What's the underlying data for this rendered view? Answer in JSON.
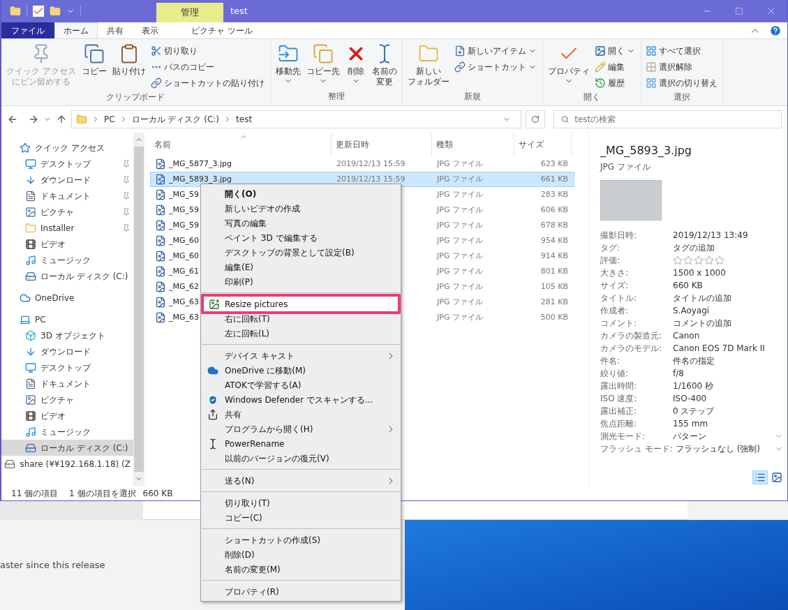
{
  "window": {
    "title": "test",
    "context_header": "管理"
  },
  "ribbon_tabs": [
    {
      "label": "ファイル",
      "kind": "file",
      "selected": false
    },
    {
      "label": "ホーム",
      "kind": "tab",
      "selected": true
    },
    {
      "label": "共有",
      "kind": "tab",
      "selected": false
    },
    {
      "label": "表示",
      "kind": "tab",
      "selected": false
    },
    {
      "label": "ピクチャ ツール",
      "kind": "context",
      "selected": false
    }
  ],
  "ribbon_groups": [
    {
      "label": "クリップボード",
      "large": [
        {
          "lines": [
            "クイック アクセス",
            "にピン留めする"
          ],
          "kind": "pin",
          "dropdown": false,
          "disabled": true
        },
        {
          "label": "コピー",
          "kind": "copy",
          "dropdown": false,
          "disabled": false
        },
        {
          "label": "貼り付け",
          "kind": "paste",
          "dropdown": false,
          "disabled": false
        }
      ],
      "small": [
        {
          "label": "切り取り",
          "kind": "cut",
          "dropdown": false
        },
        {
          "label": "パスのコピー",
          "kind": "path",
          "dropdown": false
        },
        {
          "label": "ショートカットの貼り付け",
          "kind": "shortcut",
          "dropdown": false
        }
      ]
    },
    {
      "label": "整理",
      "large": [
        {
          "label": "移動先",
          "kind": "move",
          "dropdown": true,
          "disabled": false
        },
        {
          "label": "コピー先",
          "kind": "copyto",
          "dropdown": true,
          "disabled": false
        },
        {
          "label": "削除",
          "kind": "delete",
          "dropdown": true,
          "disabled": false
        },
        {
          "lines": [
            "名前の",
            "変更"
          ],
          "kind": "rename",
          "dropdown": false,
          "disabled": false
        }
      ]
    },
    {
      "label": "新規",
      "large": [
        {
          "lines": [
            "新しい",
            "フォルダー"
          ],
          "kind": "folder",
          "dropdown": false,
          "disabled": false
        }
      ],
      "small": [
        {
          "label": "新しいアイテム",
          "kind": "newitem",
          "dropdown": true
        },
        {
          "label": "ショートカット",
          "kind": "shortcut",
          "dropdown": true
        }
      ]
    },
    {
      "label": "開く",
      "large": [
        {
          "label": "プロパティ",
          "kind": "properties",
          "dropdown": true,
          "disabled": false
        }
      ],
      "small": [
        {
          "label": "開く",
          "kind": "open",
          "dropdown": true
        },
        {
          "label": "編集",
          "kind": "edit",
          "dropdown": false
        },
        {
          "label": "履歴",
          "kind": "history",
          "dropdown": false
        }
      ]
    },
    {
      "label": "選択",
      "small": [
        {
          "label": "すべて選択",
          "kind": "selectall",
          "dropdown": false
        },
        {
          "label": "選択解除",
          "kind": "selectnone",
          "dropdown": false
        },
        {
          "label": "選択の切り替え",
          "kind": "invert",
          "dropdown": false
        }
      ]
    }
  ],
  "address": {
    "path": [
      "PC",
      "ローカル ディスク (C:)",
      "test"
    ]
  },
  "search": {
    "placeholder": "testの検索"
  },
  "nav": [
    {
      "label": "クイック アクセス",
      "kind": "star",
      "selected": false,
      "children": [
        {
          "label": "デスクトップ",
          "kind": "desktop",
          "pinned": true,
          "selected": false
        },
        {
          "label": "ダウンロード",
          "kind": "download",
          "pinned": true,
          "selected": false
        },
        {
          "label": "ドキュメント",
          "kind": "document",
          "pinned": true,
          "selected": false
        },
        {
          "label": "ピクチャ",
          "kind": "picture",
          "pinned": true,
          "selected": false
        },
        {
          "label": "Installer",
          "kind": "folder",
          "pinned": true,
          "selected": false
        },
        {
          "label": "ビデオ",
          "kind": "video",
          "pinned": false,
          "selected": false
        },
        {
          "label": "ミュージック",
          "kind": "music",
          "pinned": false,
          "selected": false
        },
        {
          "label": "ローカル ディスク (C:)",
          "kind": "drive",
          "pinned": false,
          "selected": false
        }
      ]
    },
    {
      "label": "OneDrive",
      "kind": "cloud",
      "selected": false
    },
    {
      "label": "PC",
      "kind": "pc",
      "selected": false,
      "children": [
        {
          "label": "3D オブジェクト",
          "kind": "cube",
          "pinned": false,
          "selected": false
        },
        {
          "label": "ダウンロード",
          "kind": "download",
          "pinned": false,
          "selected": false
        },
        {
          "label": "デスクトップ",
          "kind": "desktop",
          "pinned": false,
          "selected": false
        },
        {
          "label": "ドキュメント",
          "kind": "document",
          "pinned": false,
          "selected": false
        },
        {
          "label": "ピクチャ",
          "kind": "picture",
          "pinned": false,
          "selected": false
        },
        {
          "label": "ビデオ",
          "kind": "video",
          "pinned": false,
          "selected": false
        },
        {
          "label": "ミュージック",
          "kind": "music",
          "pinned": false,
          "selected": false
        },
        {
          "label": "ローカル ディスク (C:)",
          "kind": "drive",
          "pinned": false,
          "selected": true
        },
        {
          "label": "share (¥¥192.168.1.18) (Z",
          "kind": "network",
          "pinned": false,
          "selected": false
        }
      ]
    }
  ],
  "file_list": {
    "columns": [
      "名前",
      "更新日時",
      "種類",
      "サイズ"
    ],
    "rows": [
      {
        "name": "_MG_5877_3.jpg",
        "modified": "2019/12/13 15:59",
        "type": "JPG ファイル",
        "size": "623 KB",
        "selected": false
      },
      {
        "name": "_MG_5893_3.jpg",
        "modified": "2019/12/13 15:59",
        "type": "JPG ファイル",
        "size": "661 KB",
        "selected": true
      },
      {
        "name": "_MG_59",
        "type": "JPG ファイル",
        "size": "283 KB",
        "selected": false
      },
      {
        "name": "_MG_59",
        "type": "JPG ファイル",
        "size": "606 KB",
        "selected": false
      },
      {
        "name": "_MG_59",
        "type": "JPG ファイル",
        "size": "678 KB",
        "selected": false
      },
      {
        "name": "_MG_60",
        "type": "JPG ファイル",
        "size": "954 KB",
        "selected": false
      },
      {
        "name": "_MG_60",
        "type": "JPG ファイル",
        "size": "914 KB",
        "selected": false
      },
      {
        "name": "_MG_61",
        "type": "JPG ファイル",
        "size": "801 KB",
        "selected": false
      },
      {
        "name": "_MG_62",
        "type": "JPG ファイル",
        "size": "105 KB",
        "selected": false
      },
      {
        "name": "_MG_63",
        "type": "JPG ファイル",
        "size": "281 KB",
        "selected": false
      },
      {
        "name": "_MG_63",
        "type": "JPG ファイル",
        "size": "500 KB",
        "selected": false
      }
    ]
  },
  "context_menu": [
    {
      "kind": "item",
      "label": "開く(O)",
      "bold": true,
      "submenu": false,
      "highlighted": false
    },
    {
      "kind": "item",
      "label": "新しいビデオの作成",
      "bold": false,
      "submenu": false,
      "highlighted": false
    },
    {
      "kind": "item",
      "label": "写真の編集",
      "bold": false,
      "submenu": false,
      "highlighted": false
    },
    {
      "kind": "item",
      "label": "ペイント 3D で編集する",
      "bold": false,
      "submenu": false,
      "highlighted": false
    },
    {
      "kind": "item",
      "label": "デスクトップの背景として設定(B)",
      "bold": false,
      "submenu": false,
      "highlighted": false
    },
    {
      "kind": "item",
      "label": "編集(E)",
      "bold": false,
      "submenu": false,
      "highlighted": false
    },
    {
      "kind": "item",
      "label": "印刷(P)",
      "bold": false,
      "submenu": false,
      "highlighted": false
    },
    {
      "kind": "separator"
    },
    {
      "kind": "resize",
      "label": "Resize pictures",
      "bold": false,
      "submenu": false,
      "highlighted": true
    },
    {
      "kind": "item",
      "label": "右に回転(T)",
      "bold": false,
      "submenu": false,
      "highlighted": false
    },
    {
      "kind": "item",
      "label": "左に回転(L)",
      "bold": false,
      "submenu": false,
      "highlighted": false
    },
    {
      "kind": "separator"
    },
    {
      "kind": "item",
      "label": "デバイス キャスト",
      "bold": false,
      "submenu": true,
      "highlighted": false
    },
    {
      "kind": "cloud",
      "label": "OneDrive に移動(M)",
      "bold": false,
      "submenu": false,
      "highlighted": false
    },
    {
      "kind": "item",
      "label": "ATOKで学習する(A)",
      "bold": false,
      "submenu": false,
      "highlighted": false
    },
    {
      "kind": "shield",
      "label": "Windows Defender でスキャンする...",
      "bold": false,
      "submenu": false,
      "highlighted": false
    },
    {
      "kind": "share",
      "label": "共有",
      "bold": false,
      "submenu": false,
      "highlighted": false
    },
    {
      "kind": "item",
      "label": "プログラムから開く(H)",
      "bold": false,
      "submenu": true,
      "highlighted": false
    },
    {
      "kind": "cursor",
      "label": "PowerRename",
      "bold": false,
      "submenu": false,
      "highlighted": false
    },
    {
      "kind": "item",
      "label": "以前のバージョンの復元(V)",
      "bold": false,
      "submenu": false,
      "highlighted": false
    },
    {
      "kind": "separator"
    },
    {
      "kind": "item",
      "label": "送る(N)",
      "bold": false,
      "submenu": true,
      "highlighted": false
    },
    {
      "kind": "separator"
    },
    {
      "kind": "item",
      "label": "切り取り(T)",
      "bold": false,
      "submenu": false,
      "highlighted": false
    },
    {
      "kind": "item",
      "label": "コピー(C)",
      "bold": false,
      "submenu": false,
      "highlighted": false
    },
    {
      "kind": "separator"
    },
    {
      "kind": "item",
      "label": "ショートカットの作成(S)",
      "bold": false,
      "submenu": false,
      "highlighted": false
    },
    {
      "kind": "item",
      "label": "削除(D)",
      "bold": false,
      "submenu": false,
      "highlighted": false
    },
    {
      "kind": "item",
      "label": "名前の変更(M)",
      "bold": false,
      "submenu": false,
      "highlighted": false
    },
    {
      "kind": "separator"
    },
    {
      "kind": "item",
      "label": "プロパティ(R)",
      "bold": false,
      "submenu": false,
      "highlighted": false
    }
  ],
  "details": {
    "name": "_MG_5893_3.jpg",
    "type": "JPG ファイル",
    "properties": [
      {
        "kind": "text",
        "label": "撮影日時:",
        "value": "2019/12/13 13:49",
        "dropdown": false
      },
      {
        "kind": "text",
        "label": "タグ:",
        "value": "タグの追加",
        "dropdown": false
      },
      {
        "kind": "rating",
        "label": "評価:",
        "stars": 0,
        "dropdown": false
      },
      {
        "kind": "text",
        "label": "大きさ:",
        "value": "1500 x 1000",
        "dropdown": false
      },
      {
        "kind": "text",
        "label": "サイズ:",
        "value": "660 KB",
        "dropdown": false
      },
      {
        "kind": "text",
        "label": "タイトル:",
        "value": "タイトルの追加",
        "dropdown": false
      },
      {
        "kind": "text",
        "label": "作成者:",
        "value": "S.Aoyagi",
        "dropdown": false
      },
      {
        "kind": "text",
        "label": "コメント:",
        "value": "コメントの追加",
        "dropdown": false
      },
      {
        "kind": "text",
        "label": "カメラの製造元:",
        "value": "Canon",
        "dropdown": false
      },
      {
        "kind": "text",
        "label": "カメラのモデル:",
        "value": "Canon EOS 7D Mark II",
        "dropdown": false
      },
      {
        "kind": "text",
        "label": "件名:",
        "value": "件名の指定",
        "dropdown": false
      },
      {
        "kind": "text",
        "label": "絞り値:",
        "value": "f/8",
        "dropdown": false
      },
      {
        "kind": "text",
        "label": "露出時間:",
        "value": "1/1600 秒",
        "dropdown": false
      },
      {
        "kind": "text",
        "label": "ISO 速度:",
        "value": "ISO-400",
        "dropdown": false
      },
      {
        "kind": "text",
        "label": "露出補正:",
        "value": "0 ステップ",
        "dropdown": false
      },
      {
        "kind": "text",
        "label": "焦点距離:",
        "value": "155 mm",
        "dropdown": false
      },
      {
        "kind": "text",
        "label": "測光モード:",
        "value": "パターン",
        "dropdown": true
      },
      {
        "kind": "text",
        "label": "フラッシュ モード:",
        "value": "フラッシュなし (強制)",
        "dropdown": true
      }
    ],
    "views": [
      {
        "kind": "details",
        "selected": true
      },
      {
        "kind": "preview",
        "selected": false
      }
    ]
  },
  "status_bar": {
    "count": "11 個の項目",
    "selection": "1 個の項目を選択",
    "size": "660 KB"
  },
  "background": {
    "text": "aster since this release"
  }
}
